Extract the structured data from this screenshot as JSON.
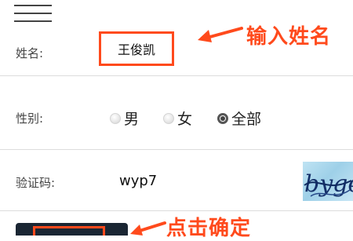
{
  "form": {
    "name_label": "姓名:",
    "name_value": "王俊凯",
    "gender_label": "性别:",
    "gender_options": [
      {
        "label": "男",
        "checked": false
      },
      {
        "label": "女",
        "checked": false
      },
      {
        "label": "全部",
        "checked": true
      }
    ],
    "captcha_label": "验证码:",
    "captcha_value": "wyp7",
    "captcha_image_text": "byge"
  },
  "annotations": {
    "name_hint": "输入姓名",
    "confirm_hint": "点击确定"
  },
  "colors": {
    "accent": "#ff4a1c",
    "button": "#1a2633"
  }
}
